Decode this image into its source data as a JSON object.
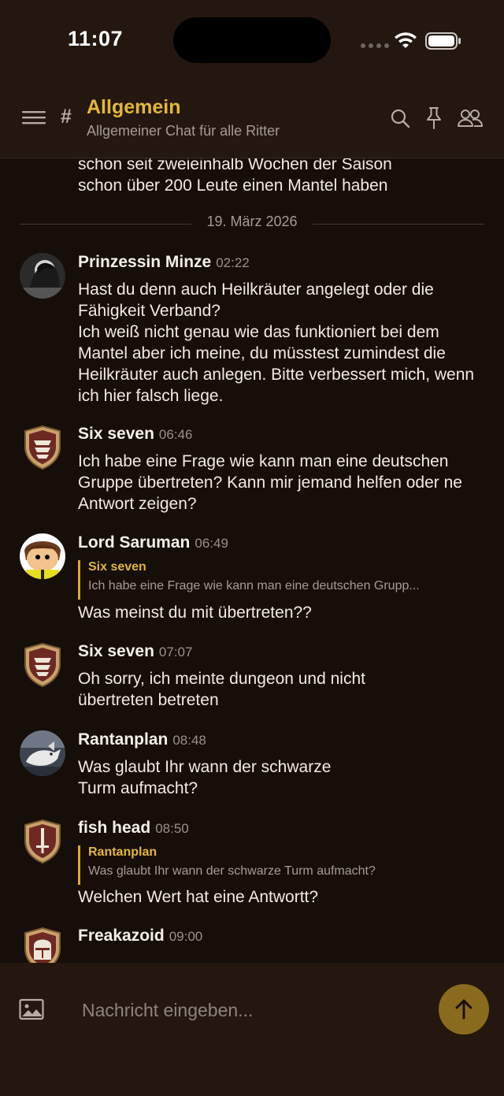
{
  "status_bar": {
    "time": "11:07"
  },
  "header": {
    "channel_name": "Allgemein",
    "channel_description": "Allgemeiner Chat für alle Ritter"
  },
  "chat": {
    "continued_message": "schon seit zweieinhalb Wochen der Saison\nschon über 200 Leute einen Mantel haben",
    "date_divider": "19. März 2026",
    "messages": [
      {
        "author": "Prinzessin Minze",
        "time": "02:22",
        "text": "Hast du denn auch Heilkräuter angelegt oder die Fähigkeit Verband?\n Ich weiß nicht genau wie das funktioniert bei dem Mantel aber ich meine, du müsstest zumindest die Heilkräuter auch anlegen. Bitte verbessert mich, wenn ich hier falsch liege."
      },
      {
        "author": "Six seven",
        "time": "06:46",
        "text": "Ich habe eine Frage wie kann man eine deutschen Gruppe übertreten? Kann mir jemand helfen oder ne Antwort zeigen?"
      },
      {
        "author": "Lord Saruman",
        "time": "06:49",
        "reply_author": "Six seven",
        "reply_text": "Ich habe eine Frage wie kann man eine deutschen Grupp...",
        "text": "Was meinst du mit übertreten??"
      },
      {
        "author": "Six seven",
        "time": "07:07",
        "text": "Oh sorry, ich meinte dungeon und nicht\nübertreten betreten"
      },
      {
        "author": "Rantanplan",
        "time": "08:48",
        "text": "Was glaubt Ihr wann der schwarze\nTurm aufmacht?"
      },
      {
        "author": "fish head",
        "time": "08:50",
        "reply_author": "Rantanplan",
        "reply_text": "Was glaubt Ihr wann der schwarze Turm aufmacht?",
        "text": "Welchen Wert hat eine Antwortt?"
      },
      {
        "author": "Freakazoid",
        "time": "09:00"
      }
    ]
  },
  "composer": {
    "placeholder": "Nachricht eingeben..."
  },
  "colors": {
    "accent": "#e2b73a",
    "background": "#160e09",
    "header_background": "#24170f",
    "send_button": "#8a6a1c"
  }
}
